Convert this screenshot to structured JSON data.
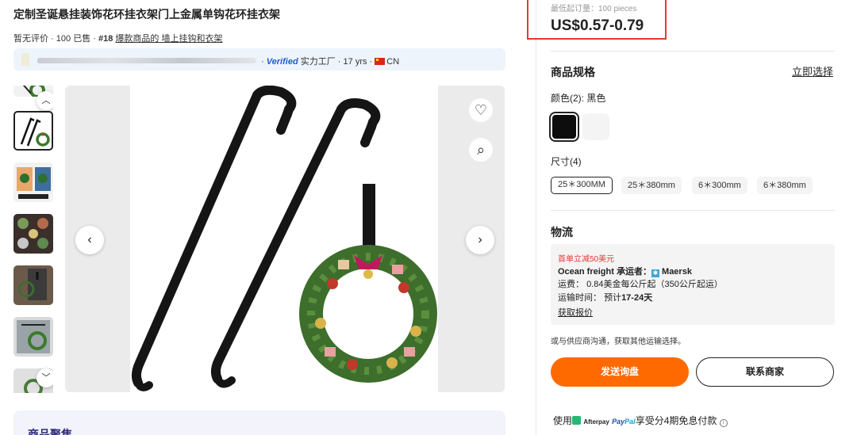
{
  "product": {
    "title": "定制圣诞悬挂装饰花环挂衣架门上金属单钩花环挂衣架",
    "rating": "暂无评价",
    "sold": "100 已售",
    "rank": "#18",
    "rank_link": "爆款商品的 墙上挂钩和衣架",
    "sep": " · "
  },
  "supplier": {
    "verified": "Verified",
    "type": "实力工厂",
    "years": "17 yrs",
    "country": "CN"
  },
  "gallery": {
    "thumbs_count": 7,
    "selected_index": 1,
    "prev": "‹",
    "next": "›",
    "up": "︿",
    "down": "﹀",
    "fav": "♡",
    "search": "⌕"
  },
  "ai_section": {
    "label": "商品聚焦"
  },
  "pricing": {
    "moq": "最低起订量：100 pieces",
    "price": "US$0.57-0.79"
  },
  "specs": {
    "title": "商品规格",
    "select_now": "立即选择",
    "color_label": "颜色(2): 黑色",
    "colors": [
      "#0d0d0d",
      "#f4f4f4"
    ],
    "size_label": "尺寸(4)",
    "sizes": [
      "25＊300MM",
      "25＊380mm",
      "6＊300mm",
      "6＊380mm"
    ],
    "selected_size": 0
  },
  "logistics": {
    "title": "物流",
    "promo": "首单立减50美元",
    "carrier_label": "Ocean freight 承运者：",
    "carrier": "Maersk",
    "fee_label": "运费：",
    "fee": "0.84美金每公斤起（350公斤起运）",
    "time_label": "运输时间：",
    "time_prefix": "预计",
    "time_value": "17-24天",
    "quote": "获取报价",
    "note": "或与供应商沟通，获取其他运输选择。"
  },
  "actions": {
    "inquiry": "发送询盘",
    "contact": "联系商家"
  },
  "payment": {
    "prefix": "使用",
    "afterpay": "Afterpay",
    "paypal_pay": "Pay",
    "paypal_pal": "Pal",
    "suffix": "享受分4期免息付款",
    "info": "i"
  }
}
